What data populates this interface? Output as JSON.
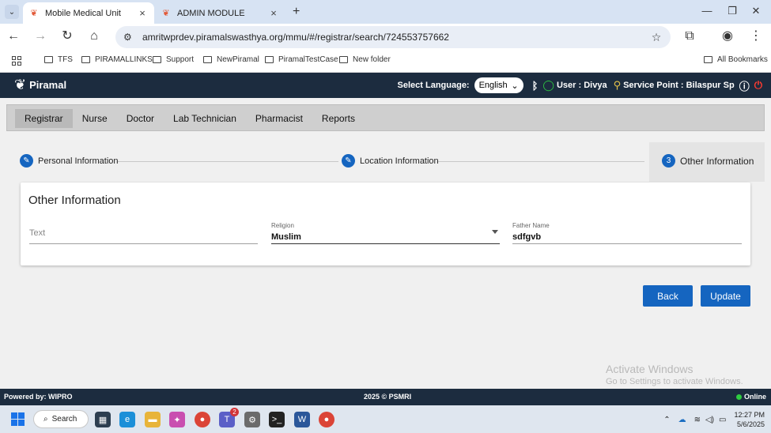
{
  "browser": {
    "tabs": [
      {
        "title": "Mobile Medical Unit",
        "active": true
      },
      {
        "title": "ADMIN MODULE",
        "active": false
      }
    ],
    "url": "amritwprdev.piramalswasthya.org/mmu/#/registrar/search/724553757662",
    "bookmarks": [
      "TFS",
      "PIRAMALLINKS",
      "Support",
      "NewPiramal",
      "PiramalTestCase",
      "New folder"
    ],
    "all_bookmarks": "All Bookmarks"
  },
  "header": {
    "logo": "Piramal",
    "select_language_label": "Select Language:",
    "language": "English",
    "user": "User : Divya",
    "service_point": "Service Point : Bilaspur Sp"
  },
  "roles": [
    "Registrar",
    "Nurse",
    "Doctor",
    "Lab Technician",
    "Pharmacist",
    "Reports"
  ],
  "stepper": {
    "steps": [
      {
        "label": "Personal Information",
        "state": "edit"
      },
      {
        "label": "Location Information",
        "state": "edit"
      },
      {
        "label": "Other Information",
        "state": "active",
        "number": "3"
      }
    ]
  },
  "form": {
    "title": "Other Information",
    "text_placeholder": "Text",
    "religion_label": "Religion",
    "religion_value": "Muslim",
    "father_label": "Father Name",
    "father_value": "sdfgvb",
    "back_button": "Back",
    "update_button": "Update"
  },
  "watermark": {
    "line1": "Activate Windows",
    "line2": "Go to Settings to activate Windows."
  },
  "footer": {
    "powered_by": "Powered by: WIPRO",
    "copyright": "2025 © PSMRI",
    "status": "Online"
  },
  "taskbar": {
    "search": "Search",
    "time": "12:27 PM",
    "date": "5/6/2025",
    "teams_badge": "2"
  }
}
